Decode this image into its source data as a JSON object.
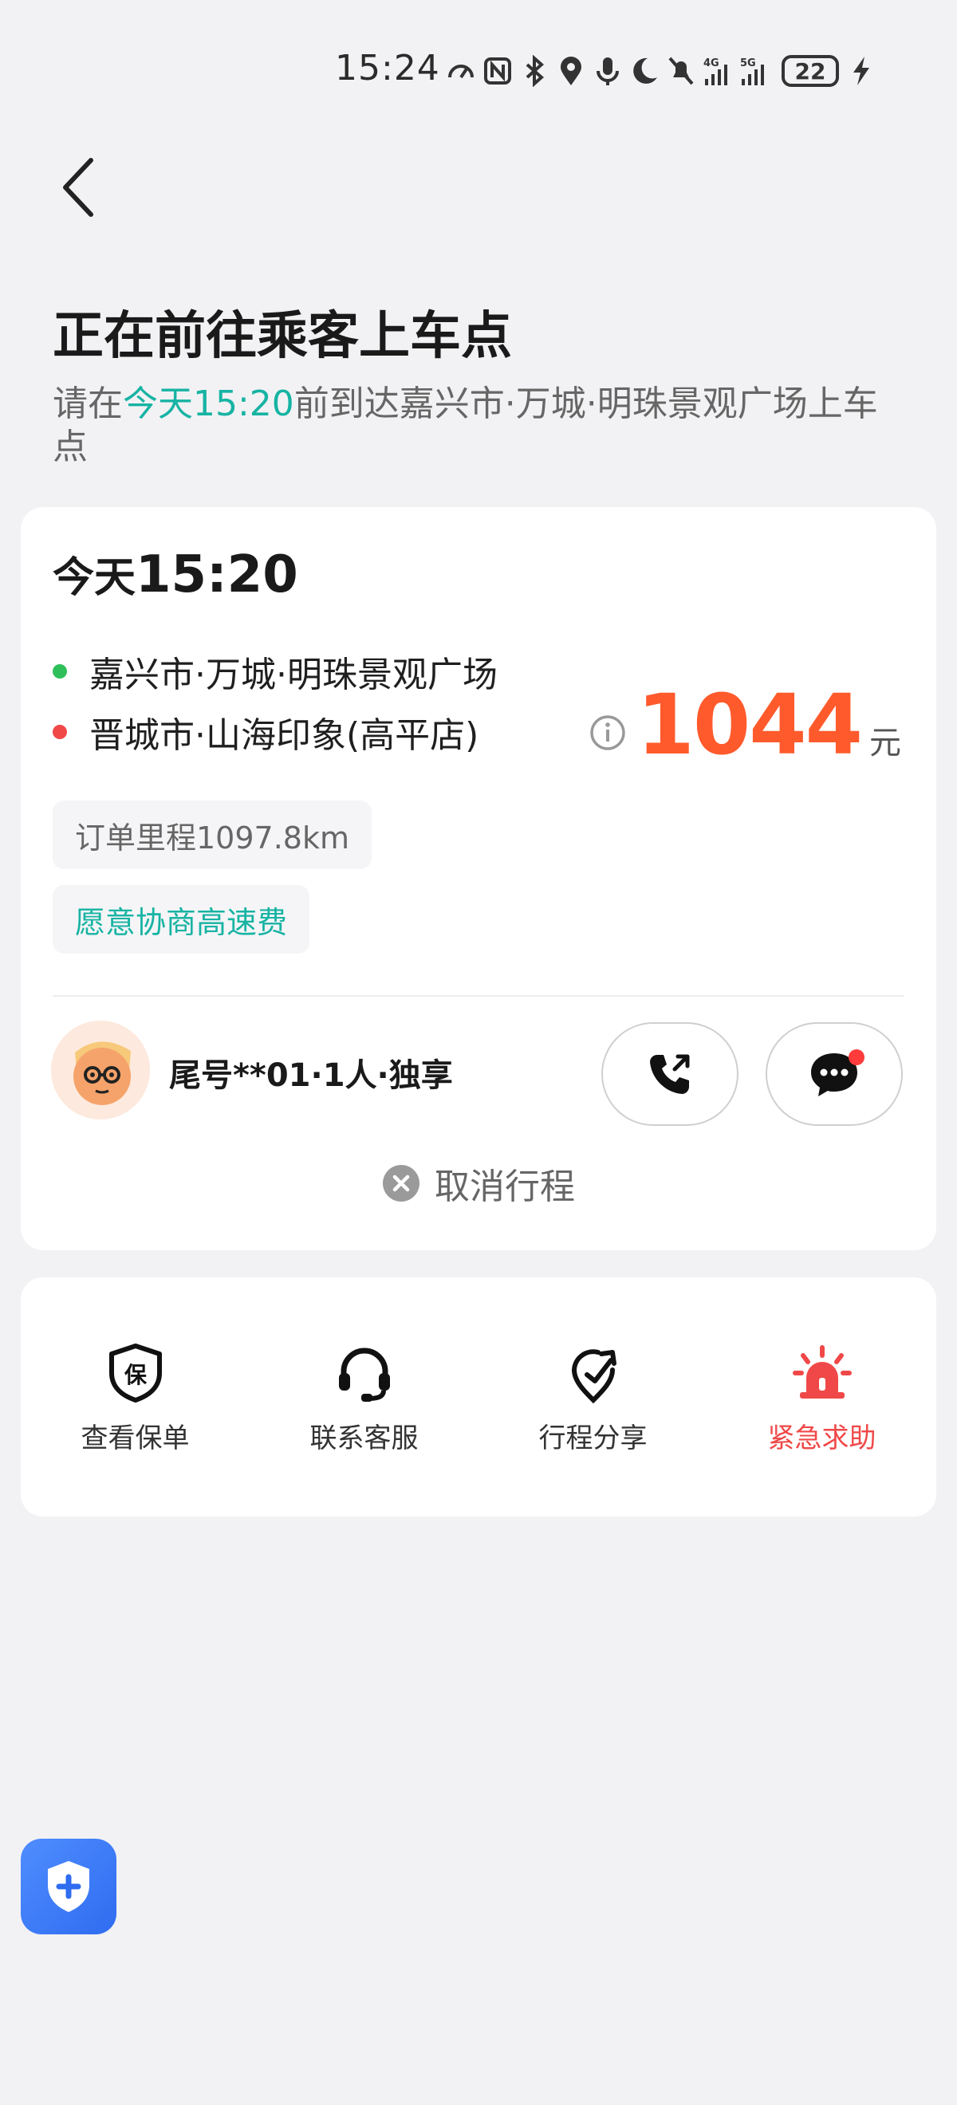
{
  "status_bar": {
    "time": "15:24",
    "battery": "22",
    "icons": [
      "speed-icon",
      "nfc-icon",
      "bluetooth-icon",
      "location-icon",
      "mic-icon",
      "moon-icon",
      "mute-icon",
      "signal-4g-icon",
      "signal-5g-icon",
      "battery-icon",
      "charging-icon"
    ]
  },
  "header": {
    "title": "正在前往乘客上车点",
    "subtitle_prefix": "请在",
    "subtitle_time": "今天15:20",
    "subtitle_suffix": "前到达嘉兴市·万城·明珠景观广场上车点"
  },
  "order": {
    "day": "今天",
    "time": "15:20",
    "origin": "嘉兴市·万城·明珠景观广场",
    "destination": "晋城市·山海印象(高平店)",
    "price": "1044",
    "price_unit": "元",
    "mileage": "订单里程1097.8km",
    "toll_tag": "愿意协商高速费",
    "passenger": "尾号**01·1人·独享",
    "cancel_label": "取消行程",
    "colors": {
      "origin_dot": "#2fbf5a",
      "destination_dot": "#f04848",
      "price": "#ff5a2c",
      "accent": "#17b3a3"
    }
  },
  "actions": [
    {
      "label": "查看保单",
      "icon": "insurance-icon"
    },
    {
      "label": "联系客服",
      "icon": "headset-icon"
    },
    {
      "label": "行程分享",
      "icon": "share-location-icon"
    },
    {
      "label": "紧急求助",
      "icon": "emergency-siren-icon"
    }
  ]
}
